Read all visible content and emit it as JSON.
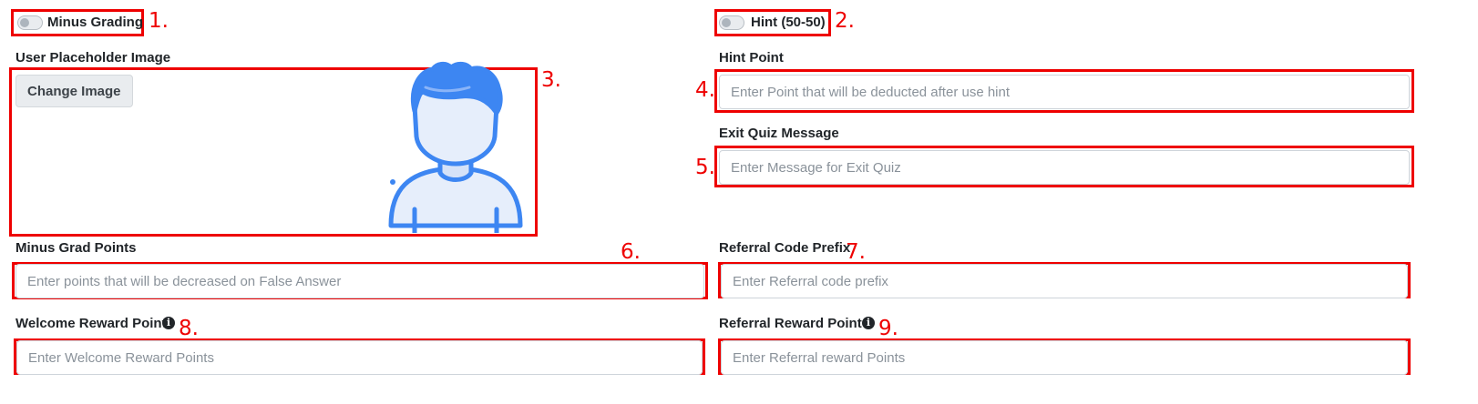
{
  "minus_grading": {
    "label": "Minus Grading",
    "annotation": "1."
  },
  "hint": {
    "label": "Hint (50-50)",
    "annotation": "2."
  },
  "user_placeholder": {
    "label": "User Placeholder Image",
    "change_button": "Change Image",
    "annotation": "3."
  },
  "hint_point": {
    "label": "Hint Point",
    "placeholder": "Enter Point that will be deducted after use hint",
    "annotation": "4."
  },
  "exit_quiz": {
    "label": "Exit Quiz Message",
    "placeholder": "Enter Message for Exit Quiz",
    "annotation": "5."
  },
  "minus_grad_points": {
    "label": "Minus Grad Points",
    "placeholder": "Enter points that will be decreased on False Answer",
    "annotation": "6."
  },
  "referral_prefix": {
    "label": "Referral Code Prefix",
    "placeholder": "Enter Referral code prefix",
    "annotation": "7."
  },
  "welcome_reward": {
    "label": "Welcome Reward Point",
    "placeholder": "Enter Welcome Reward Points",
    "annotation": "8."
  },
  "referral_reward": {
    "label": "Referral Reward Point",
    "placeholder": "Enter Referral reward Points",
    "annotation": "9."
  },
  "icons": {
    "info": "info-circle-icon",
    "avatar": "user-avatar-icon",
    "toggle": "toggle-switch-icon"
  },
  "colors": {
    "annotation_red": "#ee0000",
    "avatar_blue": "#3d86f2",
    "avatar_fill": "#e6eefb"
  }
}
